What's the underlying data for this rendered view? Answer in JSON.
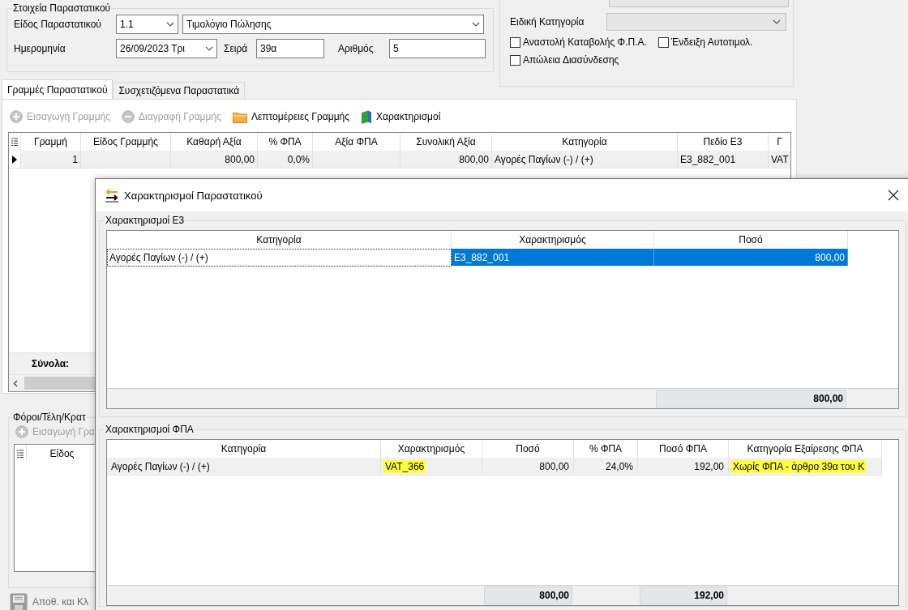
{
  "document_details": {
    "title": "Στοιχεία Παραστατικού",
    "type_label": "Είδος Παραστατικού",
    "type_code": "1.1",
    "type_name": "Τιμολόγιο Πώλησης",
    "date_label": "Ημερομηνία",
    "date": "26/09/2023 Τρι",
    "series_label": "Σειρά",
    "series": "39α",
    "number_label": "Αριθμός",
    "number": "5"
  },
  "options": {
    "special_category_label": "Ειδική Κατηγορία",
    "checkboxes": [
      {
        "label": "Αναστολή Καταβολής Φ.Π.Α.",
        "checked": false
      },
      {
        "label": "Ένδειξη Αυτοτιμολ.",
        "checked": false
      },
      {
        "label": "Απώλεια Διασύνδεσης",
        "checked": false
      }
    ]
  },
  "tabs": [
    {
      "label": "Γραμμές Παραστατικού",
      "selected": true
    },
    {
      "label": "Συσχετιζόμενα Παραστατικά",
      "selected": false
    }
  ],
  "lines_toolbar": [
    {
      "label": "Εισαγωγή Γραμμής",
      "kind": "add",
      "disabled": true
    },
    {
      "label": "Διαγραφή Γραμμής",
      "kind": "remove",
      "disabled": true
    },
    {
      "label": "Λεπτομέρειες Γραμμής",
      "kind": "details",
      "disabled": false
    },
    {
      "label": "Χαρακτηρισμοί",
      "kind": "classify",
      "disabled": false
    }
  ],
  "lines_table": {
    "columns": [
      "Γραμμή",
      "Είδος Γραμμής",
      "Καθαρή Αξία",
      "% ΦΠΑ",
      "Αξία ΦΠΑ",
      "Συνολική Αξία",
      "Κατηγορία",
      "Πεδίο Ε3",
      "Γ"
    ],
    "rows": [
      {
        "current": true,
        "cells": [
          "1",
          null,
          "800,00",
          "0,0%",
          null,
          "800,00",
          "Αγορές Παγίων (-) / (+)",
          "E3_882_001",
          "VAT"
        ]
      }
    ],
    "totals_label": "Σύνολα:"
  },
  "taxes": {
    "title": "Φόροι/Τέλη/Κρατ",
    "toolbar": [
      {
        "label": "Εισαγωγή Γρα",
        "kind": "add",
        "disabled": true
      }
    ],
    "columns": [
      "Είδος"
    ]
  },
  "save_button": {
    "label": "Αποθ. και Κλ"
  },
  "dialog": {
    "title": "Χαρακτηρισμοί Παραστατικού",
    "e3": {
      "title": "Χαρακτηρισμοί Ε3",
      "columns": [
        "Κατηγορία",
        "Χαρακτηρισμός",
        "Ποσό"
      ],
      "rows": [
        {
          "selected": true,
          "cells": [
            "Αγορές Παγίων (-) / (+)",
            "E3_882_001",
            "800,00"
          ]
        }
      ],
      "totals": {
        "amount": "800,00"
      }
    },
    "vat": {
      "title": "Χαρακτηρισμοί ΦΠΑ",
      "columns": [
        "Κατηγορία",
        "Χαρακτηρισμός",
        "Ποσό",
        "% ΦΠΑ",
        "Ποσό ΦΠΑ",
        "Κατηγορία Εξαίρεσης ΦΠΑ"
      ],
      "rows": [
        {
          "selected": false,
          "cells": [
            {
              "text": "Αγορές Παγίων (-) / (+)",
              "highlighted": false
            },
            {
              "text": "VAT_366",
              "highlighted": true
            },
            {
              "text": "800,00",
              "highlighted": false
            },
            {
              "text": "24,0%",
              "highlighted": false
            },
            {
              "text": "192,00",
              "highlighted": false
            },
            {
              "text": "Χωρίς ΦΠΑ - άρθρο 39α του Κ",
              "highlighted": true
            }
          ]
        }
      ],
      "totals": {
        "amount": "800,00",
        "vat_amount": "192,00"
      }
    }
  }
}
